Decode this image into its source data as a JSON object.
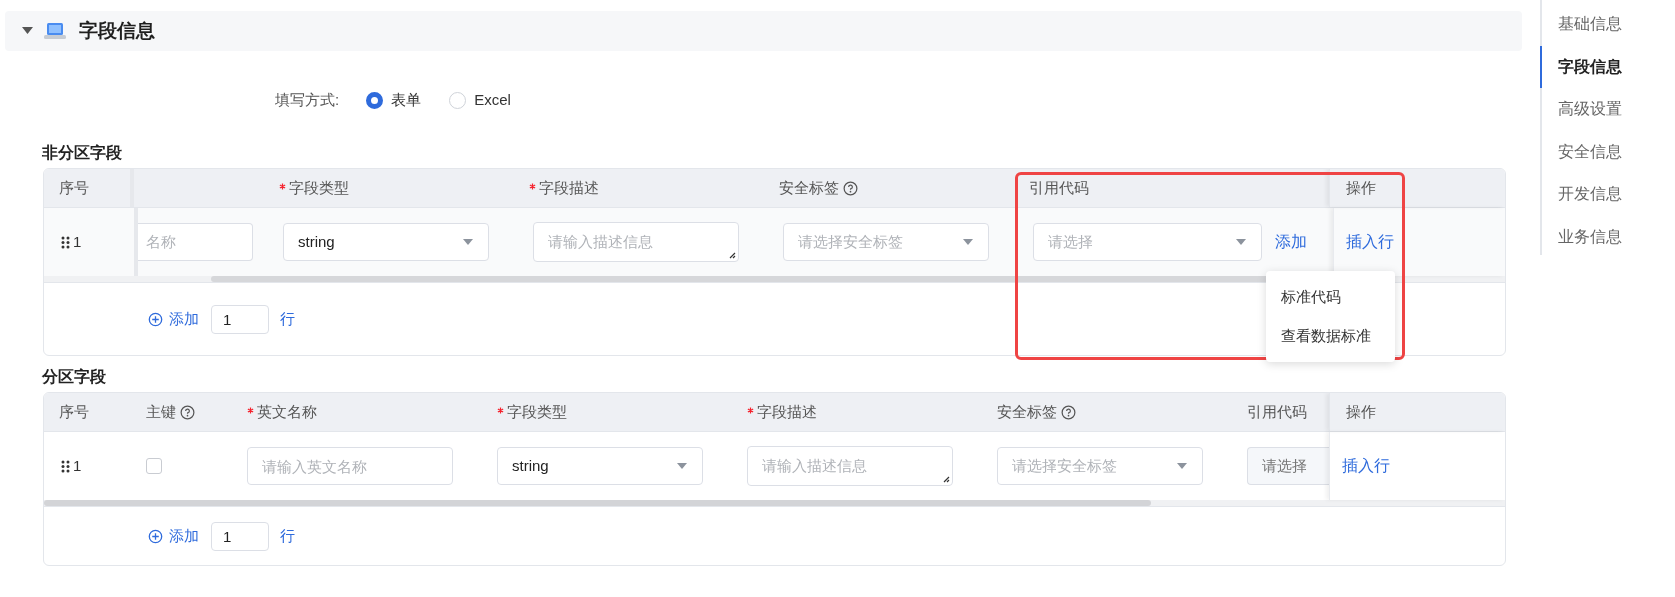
{
  "section": {
    "title": "字段信息",
    "expanded": true
  },
  "fill_mode": {
    "label": "填写方式:",
    "options": [
      {
        "label": "表单",
        "selected": true
      },
      {
        "label": "Excel",
        "selected": false
      }
    ]
  },
  "tables": [
    {
      "title": "非分区字段",
      "columns": [
        {
          "label": "序号"
        },
        {},
        {
          "label": "字段类型",
          "required": true
        },
        {
          "label": "字段描述",
          "required": true
        },
        {
          "label": "安全标签",
          "help": true
        },
        {
          "label": "引用代码"
        },
        {
          "label": "操作"
        }
      ],
      "rows": [
        {
          "cells": [
            {
              "kind": "index",
              "text": "1"
            },
            {
              "kind": "cut_input",
              "placeholder": "名称"
            },
            {
              "kind": "select",
              "value": "string"
            },
            {
              "kind": "textarea",
              "placeholder": "请输入描述信息"
            },
            {
              "kind": "select",
              "placeholder": "请选择安全标签"
            },
            {
              "kind": "select_add",
              "placeholder": "请选择",
              "link": "添加"
            },
            {
              "kind": "action",
              "link": "插入行"
            }
          ]
        }
      ],
      "add_row": {
        "button": "添加",
        "count": "1",
        "unit": "行"
      }
    },
    {
      "title": "分区字段",
      "columns": [
        {
          "label": "序号"
        },
        {
          "label": "主键",
          "help": true
        },
        {
          "label": "英文名称",
          "required": true
        },
        {
          "label": "字段类型",
          "required": true
        },
        {
          "label": "字段描述",
          "required": true
        },
        {
          "label": "安全标签",
          "help": true
        },
        {
          "label": "引用代码"
        },
        {
          "label": "操作"
        }
      ],
      "rows": [
        {
          "cells": [
            {
              "kind": "index",
              "text": "1"
            },
            {
              "kind": "checkbox",
              "checked": false
            },
            {
              "kind": "input",
              "placeholder": "请输入英文名称"
            },
            {
              "kind": "select",
              "value": "string"
            },
            {
              "kind": "textarea",
              "placeholder": "请输入描述信息"
            },
            {
              "kind": "select",
              "placeholder": "请选择安全标签"
            },
            {
              "kind": "cut_select",
              "placeholder": "请选择"
            },
            {
              "kind": "action",
              "link": "插入行"
            }
          ]
        }
      ],
      "add_row": {
        "button": "添加",
        "count": "1",
        "unit": "行"
      }
    }
  ],
  "dropdown_menu": {
    "items": [
      "标准代码",
      "查看数据标准"
    ]
  },
  "anchor_nav": [
    {
      "label": "基础信息",
      "selected": false
    },
    {
      "label": "字段信息",
      "selected": true
    },
    {
      "label": "高级设置",
      "selected": false
    },
    {
      "label": "安全信息",
      "selected": false
    },
    {
      "label": "开发信息",
      "selected": false
    },
    {
      "label": "业务信息",
      "selected": false
    }
  ]
}
